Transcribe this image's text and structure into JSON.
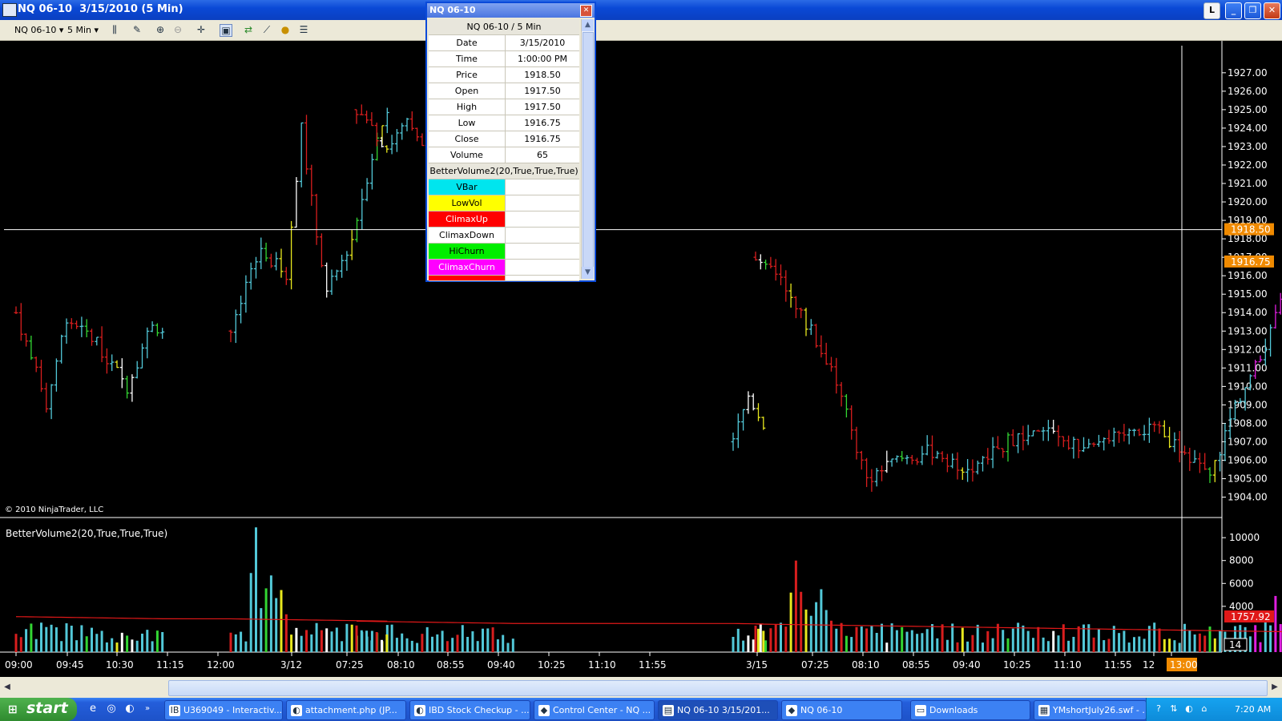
{
  "window": {
    "title": "NQ 06-10  3/15/2010 (5 Min)",
    "btn_l": "L",
    "btn_min": "_",
    "btn_max": "❐",
    "btn_close": "✕"
  },
  "toolbar": {
    "instrument": "NQ 06-10",
    "interval": "5 Min",
    "icons": [
      "bar-style-icon",
      "drawing-tools-icon",
      "zoom-in-icon",
      "zoom-out-icon",
      "crosshair-icon",
      "properties-icon",
      "strategy-icon",
      "chart-trader-icon",
      "data-series-icon",
      "data-box-icon"
    ]
  },
  "data_box": {
    "title": "NQ 06-10",
    "header": "NQ 06-10 / 5 Min",
    "rows": [
      {
        "label": "Date",
        "value": "3/15/2010"
      },
      {
        "label": "Time",
        "value": "1:00:00 PM"
      },
      {
        "label": "Price",
        "value": "1918.50"
      },
      {
        "label": "Open",
        "value": "1917.50"
      },
      {
        "label": "High",
        "value": "1917.50"
      },
      {
        "label": "Low",
        "value": "1916.75"
      },
      {
        "label": "Close",
        "value": "1916.75"
      },
      {
        "label": "Volume",
        "value": "65"
      }
    ],
    "indicator_header": "BetterVolume2(20,True,True,True)",
    "indicator_rows": [
      {
        "label": "VBar",
        "color": "#00e5ee",
        "text_color": "#000"
      },
      {
        "label": "LowVol",
        "color": "#ffff00",
        "text_color": "#000"
      },
      {
        "label": "ClimaxUp",
        "color": "#ff0000",
        "text_color": "#fff"
      },
      {
        "label": "ClimaxDown",
        "color": "#ffffff",
        "text_color": "#000"
      },
      {
        "label": "HiChurn",
        "color": "#00ee00",
        "text_color": "#000"
      },
      {
        "label": "ClimaxChurn",
        "color": "#ff00ff",
        "text_color": "#fff"
      }
    ]
  },
  "price_panel": {
    "copyright": "© 2010 NinjaTrader, LLC",
    "crosshair_price_label": "1918.50",
    "last_price_label": "1916.75"
  },
  "volume_panel": {
    "indicator_title": "BetterVolume2(20,True,True,True)",
    "ma_label": "1757.92",
    "count_label": "14"
  },
  "chart_data": {
    "type": "candlestick-ohlc",
    "y_ticks": [
      "1927.00",
      "1926.00",
      "1925.00",
      "1924.00",
      "1923.00",
      "1922.00",
      "1921.00",
      "1920.00",
      "1919.00",
      "1918.00",
      "1917.00",
      "1916.00",
      "1915.00",
      "1914.00",
      "1913.00",
      "1912.00",
      "1911.00",
      "1910.00",
      "1909.00",
      "1908.00",
      "1907.00",
      "1906.00",
      "1905.00",
      "1904.00"
    ],
    "ylim": [
      1903.2,
      1927.6
    ],
    "volume_ticks": [
      "10000",
      "8000",
      "6000",
      "4000"
    ],
    "volume_ylim": [
      0,
      11200
    ],
    "x_ticks": [
      "09:00",
      "09:45",
      "10:30",
      "11:15",
      "12:00",
      "3/12",
      "07:25",
      "08:10",
      "08:55",
      "09:40",
      "10:25",
      "11:10",
      "11:55",
      "3/15",
      "07:25",
      "08:10",
      "08:55",
      "09:40",
      "10:25",
      "11:10",
      "11:55",
      "12",
      "13:00"
    ],
    "highlight_x_tick": "13:00",
    "segments": [
      {
        "n": 30,
        "path": [
          [
            0,
            1914.0
          ],
          [
            6,
            1909.0
          ],
          [
            10,
            1913.8
          ],
          [
            16,
            1912.3
          ],
          [
            22,
            1910.0
          ],
          [
            27,
            1913.5
          ],
          [
            29,
            1913.0
          ]
        ]
      },
      {
        "n": 32,
        "path": [
          [
            0,
            1913.0
          ],
          [
            6,
            1917.5
          ],
          [
            11,
            1916.0
          ],
          [
            14,
            1924.0
          ],
          [
            16,
            1920.0
          ],
          [
            19,
            1915.0
          ],
          [
            24,
            1918.0
          ],
          [
            28,
            1922.5
          ],
          [
            31,
            1925.0
          ]
        ]
      },
      {
        "n": 32,
        "path": [
          [
            0,
            1925.0
          ],
          [
            6,
            1923.0
          ],
          [
            10,
            1924.2
          ],
          [
            15,
            1922.0
          ],
          [
            20,
            1919.0
          ],
          [
            24,
            1922.0
          ],
          [
            30,
            1923.0
          ],
          [
            31,
            1922.5
          ]
        ]
      },
      {
        "n": 7,
        "path": [
          [
            0,
            1907.0
          ],
          [
            3,
            1909.5
          ],
          [
            6,
            1908.0
          ]
        ]
      },
      {
        "n": 110,
        "path": [
          [
            0,
            1917.0
          ],
          [
            5,
            1916.0
          ],
          [
            10,
            1913.5
          ],
          [
            15,
            1911.0
          ],
          [
            22,
            1905.0
          ],
          [
            28,
            1906.0
          ],
          [
            35,
            1906.5
          ],
          [
            42,
            1905.5
          ],
          [
            50,
            1907.0
          ],
          [
            58,
            1907.5
          ],
          [
            66,
            1906.5
          ],
          [
            74,
            1907.8
          ],
          [
            80,
            1907.5
          ],
          [
            85,
            1906.5
          ],
          [
            90,
            1905.0
          ],
          [
            95,
            1909.0
          ],
          [
            100,
            1911.5
          ],
          [
            104,
            1915.0
          ],
          [
            108,
            1917.5
          ],
          [
            114,
            1917.8
          ],
          [
            122,
            1918.3
          ],
          [
            125,
            1916.8
          ]
        ]
      }
    ],
    "volume_note": "BetterVolume bars colored by type with a red 20-period volume average line"
  },
  "taskbar": {
    "start_label": "start",
    "tasks": [
      {
        "label": "U369049 - Interactiv...",
        "icon": "ib-icon"
      },
      {
        "label": "attachment.php (JP...",
        "icon": "firefox-icon"
      },
      {
        "label": "IBD Stock Checkup - ...",
        "icon": "firefox-icon"
      },
      {
        "label": "Control Center - NQ ...",
        "icon": "ninjatrader-icon"
      },
      {
        "label": "NQ 06-10  3/15/201...",
        "icon": "chart-icon"
      },
      {
        "label": "NQ 06-10",
        "icon": "ninjatrader-icon"
      },
      {
        "label": "Downloads",
        "icon": "folder-icon"
      },
      {
        "label": "YMshortJuly26.swf - ...",
        "icon": "flash-icon"
      }
    ],
    "clock": "7:20 AM"
  }
}
